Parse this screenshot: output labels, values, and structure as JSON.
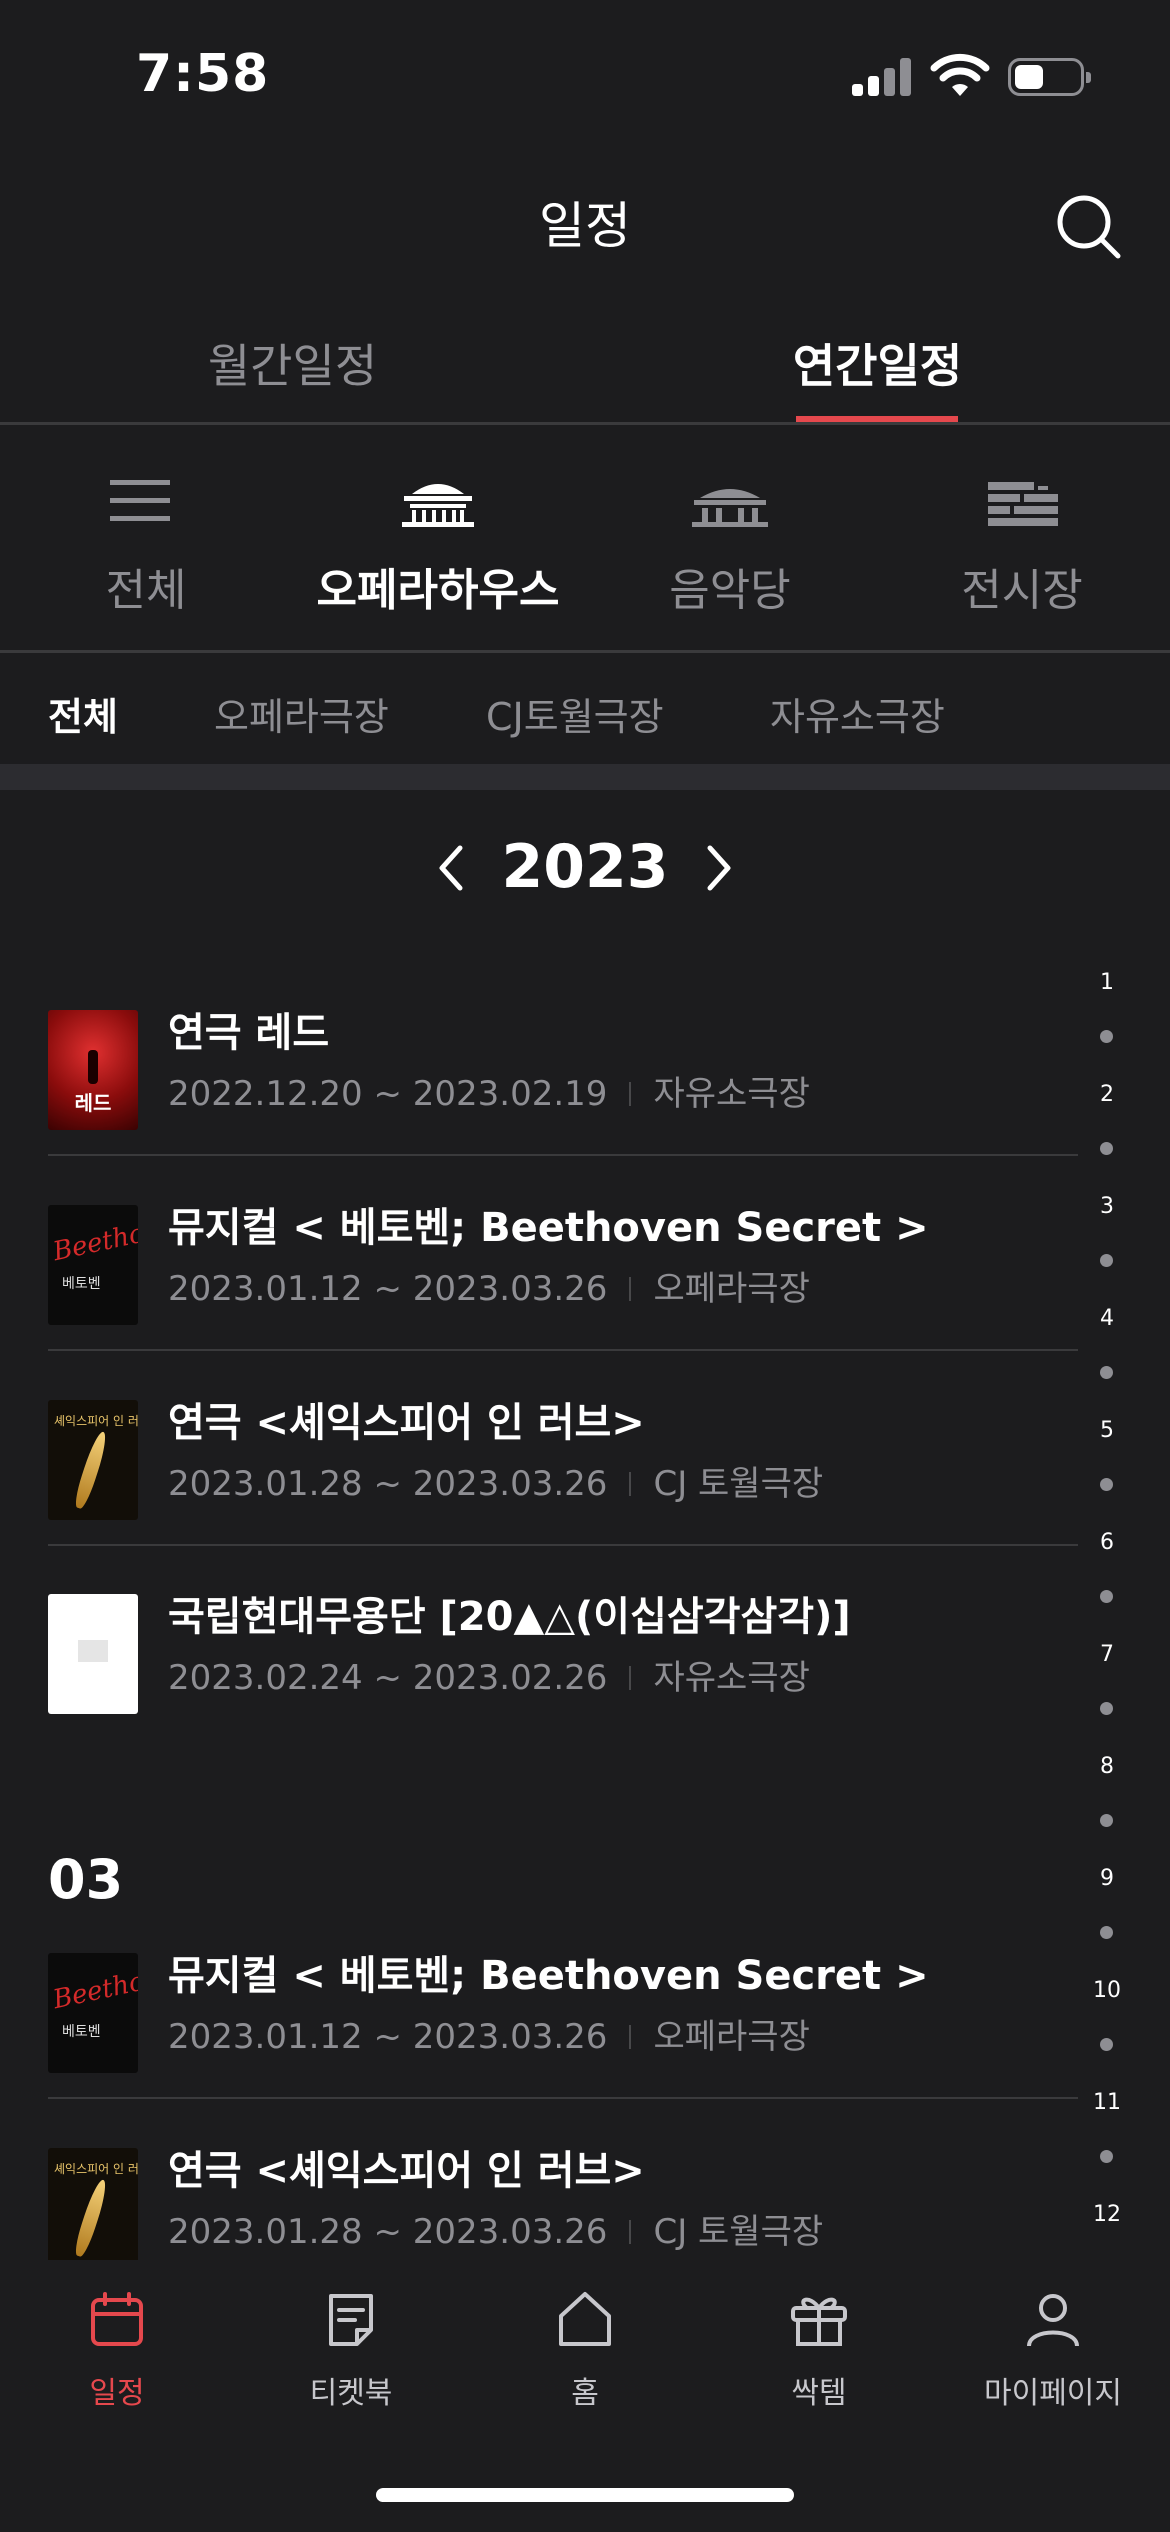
{
  "status_bar": {
    "time": "7:58"
  },
  "header": {
    "title": "일정",
    "search_icon": "search-icon"
  },
  "top_tabs": [
    {
      "label": "월간일정",
      "active": false
    },
    {
      "label": "연간일정",
      "active": true
    }
  ],
  "venues": [
    {
      "label": "전체",
      "icon": "list-icon",
      "active": false
    },
    {
      "label": "오페라하우스",
      "icon": "opera-house-icon",
      "active": true
    },
    {
      "label": "음악당",
      "icon": "concert-hall-icon",
      "active": false
    },
    {
      "label": "전시장",
      "icon": "gallery-icon",
      "active": false
    }
  ],
  "sub_tabs": [
    {
      "label": "전체",
      "active": true
    },
    {
      "label": "오페라극장",
      "active": false
    },
    {
      "label": "CJ토월극장",
      "active": false
    },
    {
      "label": "자유소극장",
      "active": false
    }
  ],
  "year": {
    "label": "2023"
  },
  "list": [
    {
      "title": "연극 레드",
      "dates": "2022.12.20 ~ 2023.02.19",
      "venue": "자유소극장",
      "poster": "red",
      "poster_text": "레드"
    },
    {
      "title": "뮤지컬 < 베토벤; Beethoven Secret >",
      "dates": "2023.01.12 ~ 2023.03.26",
      "venue": "오페라극장",
      "poster": "beethoven",
      "poster_text": "베토벤"
    },
    {
      "title": "연극 <셰익스피어 인 러브>",
      "dates": "2023.01.28 ~ 2023.03.26",
      "venue": "CJ 토월극장",
      "poster": "shakespeare",
      "poster_text": "셰익스피어 인 러브"
    },
    {
      "title": "국립현대무용단 [20▲△(이십삼각삼각)]",
      "dates": "2023.02.24 ~ 2023.02.26",
      "venue": "자유소극장",
      "poster": "white",
      "poster_text": ""
    }
  ],
  "month_section": {
    "label": "03"
  },
  "list_march": [
    {
      "title": "뮤지컬 < 베토벤; Beethoven Secret >",
      "dates": "2023.01.12 ~ 2023.03.26",
      "venue": "오페라극장",
      "poster": "beethoven",
      "poster_text": "베토벤"
    },
    {
      "title": "연극 <셰익스피어 인 러브>",
      "dates": "2023.01.28 ~ 2023.03.26",
      "venue": "CJ 토월극장",
      "poster": "shakespeare",
      "poster_text": "셰익스피어 인 러브"
    }
  ],
  "month_index": [
    "1",
    "2",
    "3",
    "4",
    "5",
    "6",
    "7",
    "8",
    "9",
    "10",
    "11",
    "12"
  ],
  "bottom_nav": [
    {
      "label": "일정",
      "icon": "calendar-icon",
      "active": true
    },
    {
      "label": "티켓북",
      "icon": "ticketbook-icon",
      "active": false
    },
    {
      "label": "홈",
      "icon": "home-icon",
      "active": false
    },
    {
      "label": "싹템",
      "icon": "gift-icon",
      "active": false
    },
    {
      "label": "마이페이지",
      "icon": "person-icon",
      "active": false
    }
  ],
  "colors": {
    "accent": "#e5484d",
    "background": "#1c1c1e",
    "muted": "#8e8e93"
  }
}
